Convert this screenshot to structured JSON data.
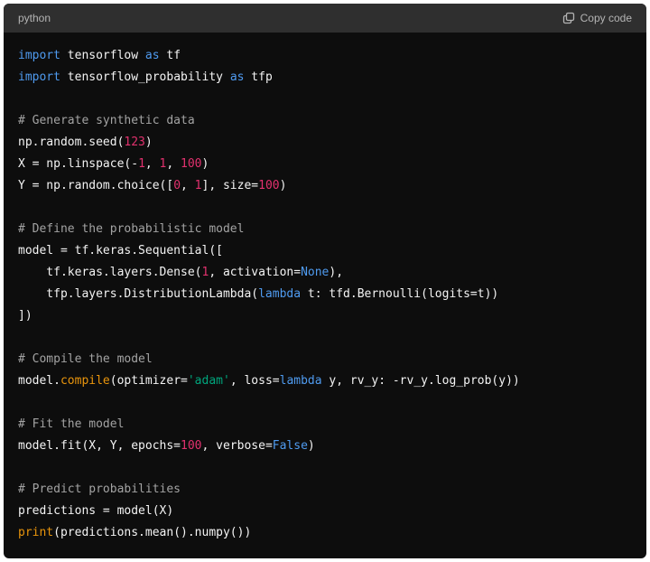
{
  "header": {
    "language": "python",
    "copy_label": "Copy code",
    "copy_icon": "copy-icon"
  },
  "colors": {
    "background": "#0d0d0d",
    "header": "#2f2f2f",
    "keyword": "#4f9bf0",
    "number": "#e2316e",
    "comment": "#a3a3a3",
    "function": "#e9950c",
    "string": "#00a67d",
    "text": "#f4f4f4"
  },
  "code": {
    "lines": [
      [
        {
          "t": "kw",
          "v": "import"
        },
        {
          "t": "plain",
          "v": " tensorflow "
        },
        {
          "t": "kw",
          "v": "as"
        },
        {
          "t": "plain",
          "v": " tf"
        }
      ],
      [
        {
          "t": "kw",
          "v": "import"
        },
        {
          "t": "plain",
          "v": " tensorflow_probability "
        },
        {
          "t": "kw",
          "v": "as"
        },
        {
          "t": "plain",
          "v": " tfp"
        }
      ],
      [],
      [
        {
          "t": "cmt",
          "v": "# Generate synthetic data"
        }
      ],
      [
        {
          "t": "plain",
          "v": "np.random.seed("
        },
        {
          "t": "num",
          "v": "123"
        },
        {
          "t": "plain",
          "v": ")"
        }
      ],
      [
        {
          "t": "plain",
          "v": "X = np.linspace(-"
        },
        {
          "t": "num",
          "v": "1"
        },
        {
          "t": "plain",
          "v": ", "
        },
        {
          "t": "num",
          "v": "1"
        },
        {
          "t": "plain",
          "v": ", "
        },
        {
          "t": "num",
          "v": "100"
        },
        {
          "t": "plain",
          "v": ")"
        }
      ],
      [
        {
          "t": "plain",
          "v": "Y = np.random.choice(["
        },
        {
          "t": "num",
          "v": "0"
        },
        {
          "t": "plain",
          "v": ", "
        },
        {
          "t": "num",
          "v": "1"
        },
        {
          "t": "plain",
          "v": "], size="
        },
        {
          "t": "num",
          "v": "100"
        },
        {
          "t": "plain",
          "v": ")"
        }
      ],
      [],
      [
        {
          "t": "cmt",
          "v": "# Define the probabilistic model"
        }
      ],
      [
        {
          "t": "plain",
          "v": "model = tf.keras.Sequential(["
        }
      ],
      [
        {
          "t": "plain",
          "v": "    tf.keras.layers.Dense("
        },
        {
          "t": "num",
          "v": "1"
        },
        {
          "t": "plain",
          "v": ", activation="
        },
        {
          "t": "kw",
          "v": "None"
        },
        {
          "t": "plain",
          "v": "),"
        }
      ],
      [
        {
          "t": "plain",
          "v": "    tfp.layers.DistributionLambda("
        },
        {
          "t": "kw",
          "v": "lambda"
        },
        {
          "t": "plain",
          "v": " t: tfd.Bernoulli(logits=t))"
        }
      ],
      [
        {
          "t": "plain",
          "v": "])"
        }
      ],
      [],
      [
        {
          "t": "cmt",
          "v": "# Compile the model"
        }
      ],
      [
        {
          "t": "plain",
          "v": "model."
        },
        {
          "t": "fn",
          "v": "compile"
        },
        {
          "t": "plain",
          "v": "(optimizer="
        },
        {
          "t": "str",
          "v": "'adam'"
        },
        {
          "t": "plain",
          "v": ", loss="
        },
        {
          "t": "kw",
          "v": "lambda"
        },
        {
          "t": "plain",
          "v": " y, rv_y: -rv_y.log_prob(y))"
        }
      ],
      [],
      [
        {
          "t": "cmt",
          "v": "# Fit the model"
        }
      ],
      [
        {
          "t": "plain",
          "v": "model.fit(X, Y, epochs="
        },
        {
          "t": "num",
          "v": "100"
        },
        {
          "t": "plain",
          "v": ", verbose="
        },
        {
          "t": "kw",
          "v": "False"
        },
        {
          "t": "plain",
          "v": ")"
        }
      ],
      [],
      [
        {
          "t": "cmt",
          "v": "# Predict probabilities"
        }
      ],
      [
        {
          "t": "plain",
          "v": "predictions = model(X)"
        }
      ],
      [
        {
          "t": "fn",
          "v": "print"
        },
        {
          "t": "plain",
          "v": "(predictions.mean().numpy())"
        }
      ]
    ]
  }
}
